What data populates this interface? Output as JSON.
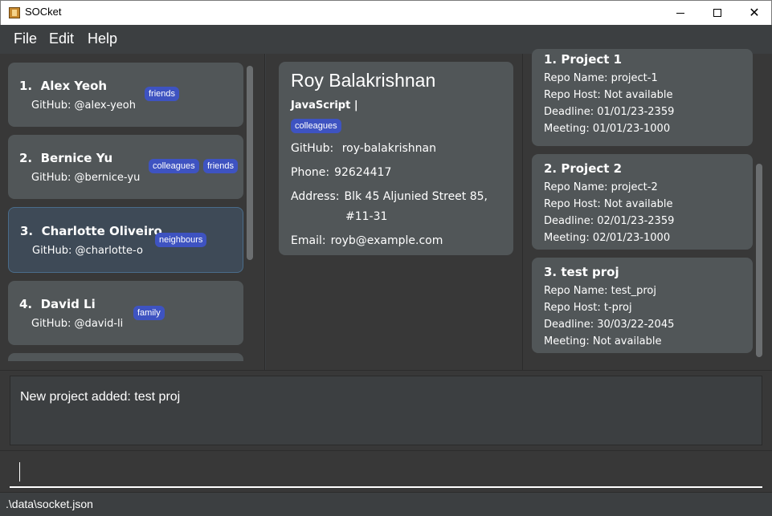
{
  "window": {
    "title": "SOCket",
    "minimize_icon": "minimize-icon",
    "maximize_icon": "maximize-icon",
    "close_symbol": "✕"
  },
  "menu": [
    "File",
    "Edit",
    "Help"
  ],
  "persons": [
    {
      "index": "1.",
      "name": "Alex Yeoh",
      "github": "GitHub: @alex-yeoh",
      "tags": [
        "friends"
      ]
    },
    {
      "index": "2.",
      "name": "Bernice Yu",
      "github": "GitHub: @bernice-yu",
      "tags": [
        "colleagues",
        "friends"
      ]
    },
    {
      "index": "3.",
      "name": "Charlotte Oliveiro",
      "github": "GitHub: @charlotte-o",
      "tags": [
        "neighbours"
      ]
    },
    {
      "index": "4.",
      "name": "David Li",
      "github": "GitHub: @david-li",
      "tags": [
        "family"
      ]
    }
  ],
  "detail": {
    "name": "Roy Balakrishnan",
    "languages": "JavaScript |",
    "tag": "colleagues",
    "github_label": "GitHub:",
    "github_value": "roy-balakrishnan",
    "phone_label": "Phone:",
    "phone_value": "92624417",
    "address_label": "Address:",
    "address_line1": "Blk 45 Aljunied Street 85,",
    "address_line2": "#11-31",
    "email_label": "Email:",
    "email_value": "royb@example.com"
  },
  "projects": [
    {
      "title": "1.  Project 1",
      "repo_name": "Repo Name: project-1",
      "repo_host": "Repo Host: Not available",
      "deadline": "Deadline: 01/01/23-2359",
      "meeting": "Meeting: 01/01/23-1000"
    },
    {
      "title": "2.  Project 2",
      "repo_name": "Repo Name: project-2",
      "repo_host": "Repo Host: Not available",
      "deadline": "Deadline: 02/01/23-2359",
      "meeting": "Meeting: 02/01/23-1000"
    },
    {
      "title": "3.  test proj",
      "repo_name": "Repo Name: test_proj",
      "repo_host": "Repo Host: t-proj",
      "deadline": "Deadline: 30/03/22-2045",
      "meeting": "Meeting: Not available"
    }
  ],
  "result": "New project added: test proj",
  "command": {
    "value": ""
  },
  "status": {
    "path": ".\\data\\socket.json"
  },
  "colors": {
    "tag": "#3e53c1",
    "card": "#515658",
    "selected_card": "#3e4a57",
    "background": "#383838"
  }
}
